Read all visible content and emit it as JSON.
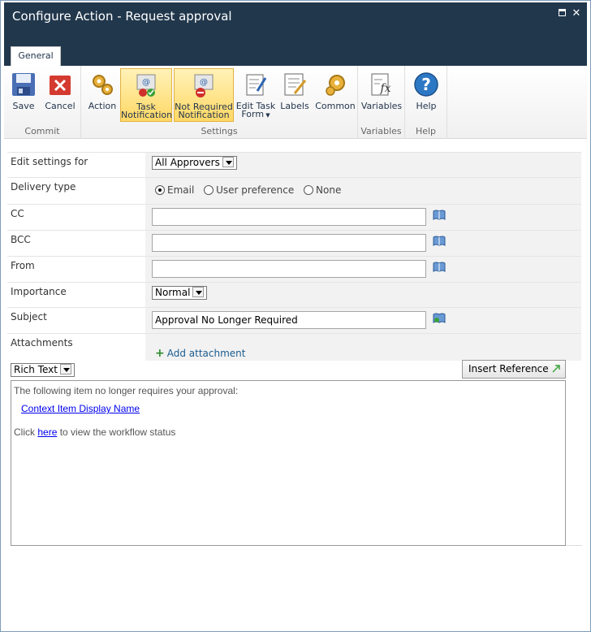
{
  "window": {
    "title": "Configure Action - Request approval"
  },
  "ribbon": {
    "tab": "General",
    "groups": [
      {
        "label": "Commit"
      },
      {
        "label": "Settings"
      },
      {
        "label": "Variables"
      },
      {
        "label": "Help"
      }
    ],
    "buttons": {
      "save": "Save",
      "cancel": "Cancel",
      "action": "Action",
      "task_notification_1": "Task",
      "task_notification_2": "Notification",
      "not_required_1": "Not Required",
      "not_required_2": "Notification",
      "edit_task_form_1": "Edit Task",
      "edit_task_form_2": "Form",
      "labels": "Labels",
      "common": "Common",
      "variables": "Variables",
      "help": "Help"
    },
    "selected": [
      "task_notification",
      "not_required_notification"
    ]
  },
  "form": {
    "edit_settings_for": {
      "label": "Edit settings for",
      "value": "All Approvers"
    },
    "delivery_type": {
      "label": "Delivery type",
      "options": [
        "Email",
        "User preference",
        "None"
      ],
      "selected": "Email"
    },
    "cc": {
      "label": "CC",
      "value": ""
    },
    "bcc": {
      "label": "BCC",
      "value": ""
    },
    "from": {
      "label": "From",
      "value": ""
    },
    "importance": {
      "label": "Importance",
      "value": "Normal"
    },
    "subject": {
      "label": "Subject",
      "value": "Approval No Longer Required"
    },
    "attachments": {
      "label": "Attachments",
      "add_link": "Add attachment"
    }
  },
  "editor": {
    "mode": "Rich Text",
    "insert_reference": "Insert Reference",
    "body_line1": "The following item no longer requires your approval:",
    "body_link": "Context Item Display Name",
    "body_line3_pre": "Click ",
    "body_line3_link": "here",
    "body_line3_post": " to view the workflow status"
  },
  "colors": {
    "titlebar": "#21374c",
    "selected_button": "#ffd865",
    "link": "#1b5d90"
  }
}
